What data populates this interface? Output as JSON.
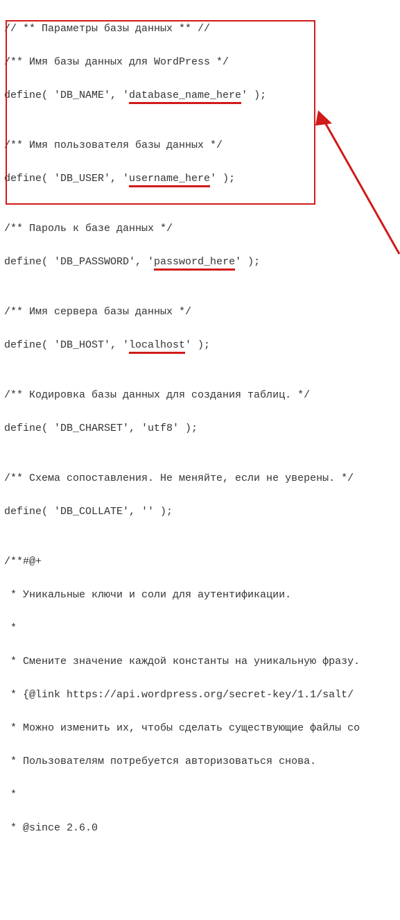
{
  "code": {
    "l01": "// ** Параметры базы данных ** //",
    "l02_a": "/** Имя базы данных для WordPress */",
    "l03_a": "define( 'DB_NAME', '",
    "l03_u": "database_name_here",
    "l03_b": "' );",
    "l04": "",
    "l05": "/** Имя пользователя базы данных */",
    "l06_a": "define( 'DB_USER', '",
    "l06_u": "username_here",
    "l06_b": "' );",
    "l07": "",
    "l08": "/** Пароль к базе данных */",
    "l09_a": "define( 'DB_PASSWORD', '",
    "l09_u": "password_here",
    "l09_b": "' );",
    "l10": "",
    "l11": "/** Имя сервера базы данных */",
    "l12_a": "define( 'DB_HOST', '",
    "l12_u": "localhost",
    "l12_b": "' );",
    "l13": "",
    "l14": "/** Кодировка базы данных для создания таблиц. */",
    "l15": "define( 'DB_CHARSET', 'utf8' );",
    "l16": "",
    "l17": "/** Схема сопоставления. Не меняйте, если не уверены. */",
    "l18": "define( 'DB_COLLATE', '' );",
    "l19": "",
    "l20": "/**#@+",
    "l21": " * Уникальные ключи и соли для аутентификации.",
    "l22": " *",
    "l23": " * Смените значение каждой константы на уникальную фразу.",
    "l24": " * {@link https://api.wordpress.org/secret-key/1.1/salt/",
    "l25": " * Можно изменить их, чтобы сделать существующие файлы co",
    "l26": " * Пользователям потребуется авторизоваться снова.",
    "l27": " *",
    "l28": " * @since 2.6.0"
  }
}
